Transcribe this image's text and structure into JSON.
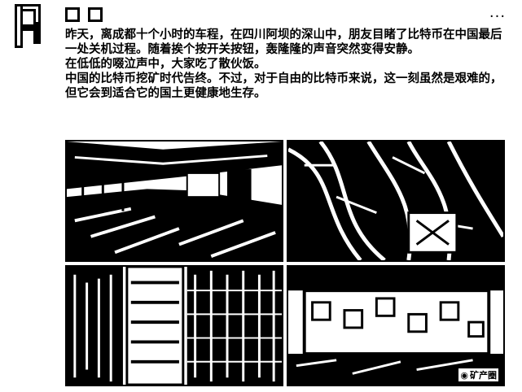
{
  "post": {
    "paragraphs": [
      "昨天，离成都十个小时的车程，在四川阿坝的深山中，朋友目睹了比特币在中国最后一处关机过程。随着挨个按开关按钮，轰隆隆的声音突然变得安静。",
      "在低低的啜泣声中，大家吃了散伙饭。",
      "中国的比特币挖矿时代告终。不过，对于自由的比特币来说，这一刻虽然是艰难的，但它会到适合它的国土更健康地生存。"
    ],
    "more_label": "...",
    "watermark": "矿产圈"
  },
  "photos": [
    {
      "name": "photo-mining-hall"
    },
    {
      "name": "photo-cables"
    },
    {
      "name": "photo-rack-aisle"
    },
    {
      "name": "photo-facility-exterior"
    }
  ],
  "icons": {
    "avatar": "avatar-logo",
    "more": "more-options-icon",
    "watermark": "wechat-icon"
  }
}
